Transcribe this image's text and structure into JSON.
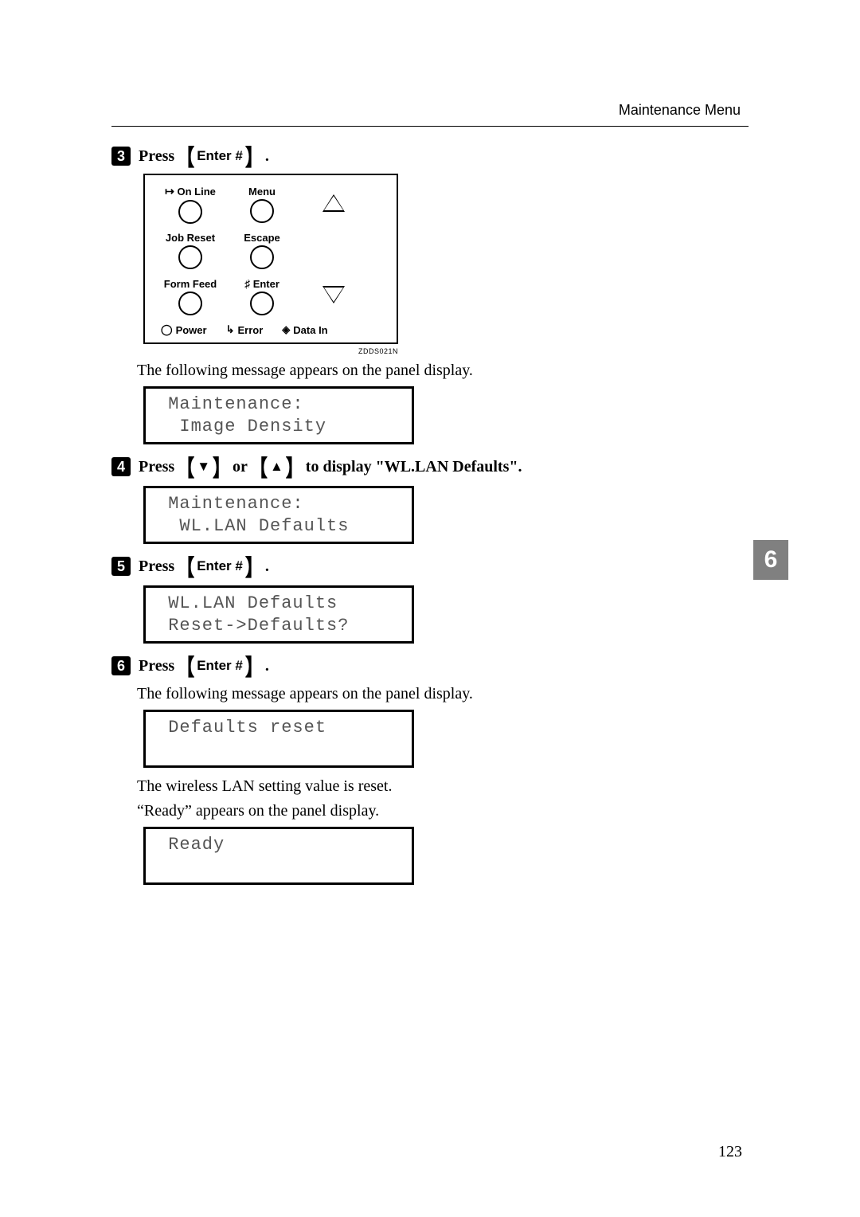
{
  "header": {
    "section": "Maintenance Menu"
  },
  "side_tab": "6",
  "page_number": "123",
  "steps": {
    "s3": {
      "num": "3",
      "pre": "Press ",
      "key": "Enter #",
      "post": "."
    },
    "s4": {
      "num": "4",
      "pre": "Press ",
      "mid": " or ",
      "post": " to display \"WL.LAN Defaults\"."
    },
    "s5": {
      "num": "5",
      "pre": "Press ",
      "key": "Enter #",
      "post": "."
    },
    "s6": {
      "num": "6",
      "pre": "Press ",
      "key": "Enter #",
      "post": "."
    }
  },
  "diagram": {
    "online": "On Line",
    "menu": "Menu",
    "jobreset": "Job Reset",
    "escape": "Escape",
    "formfeed": "Form Feed",
    "enter": "Enter",
    "power": "Power",
    "error": "Error",
    "datain": "Data In",
    "code": "ZDDS021N"
  },
  "texts": {
    "t1": "The following message appears on the panel display.",
    "t2": "The following message appears on the panel display.",
    "t3": "The wireless LAN setting value is reset.",
    "t4": "“Ready” appears on the panel display."
  },
  "lcd": {
    "d1": " Maintenance:\n  Image Density",
    "d2": " Maintenance:\n  WL.LAN Defaults",
    "d3": " WL.LAN Defaults\n Reset->Defaults?",
    "d4": " Defaults reset\n ",
    "d5": " Ready\n "
  }
}
